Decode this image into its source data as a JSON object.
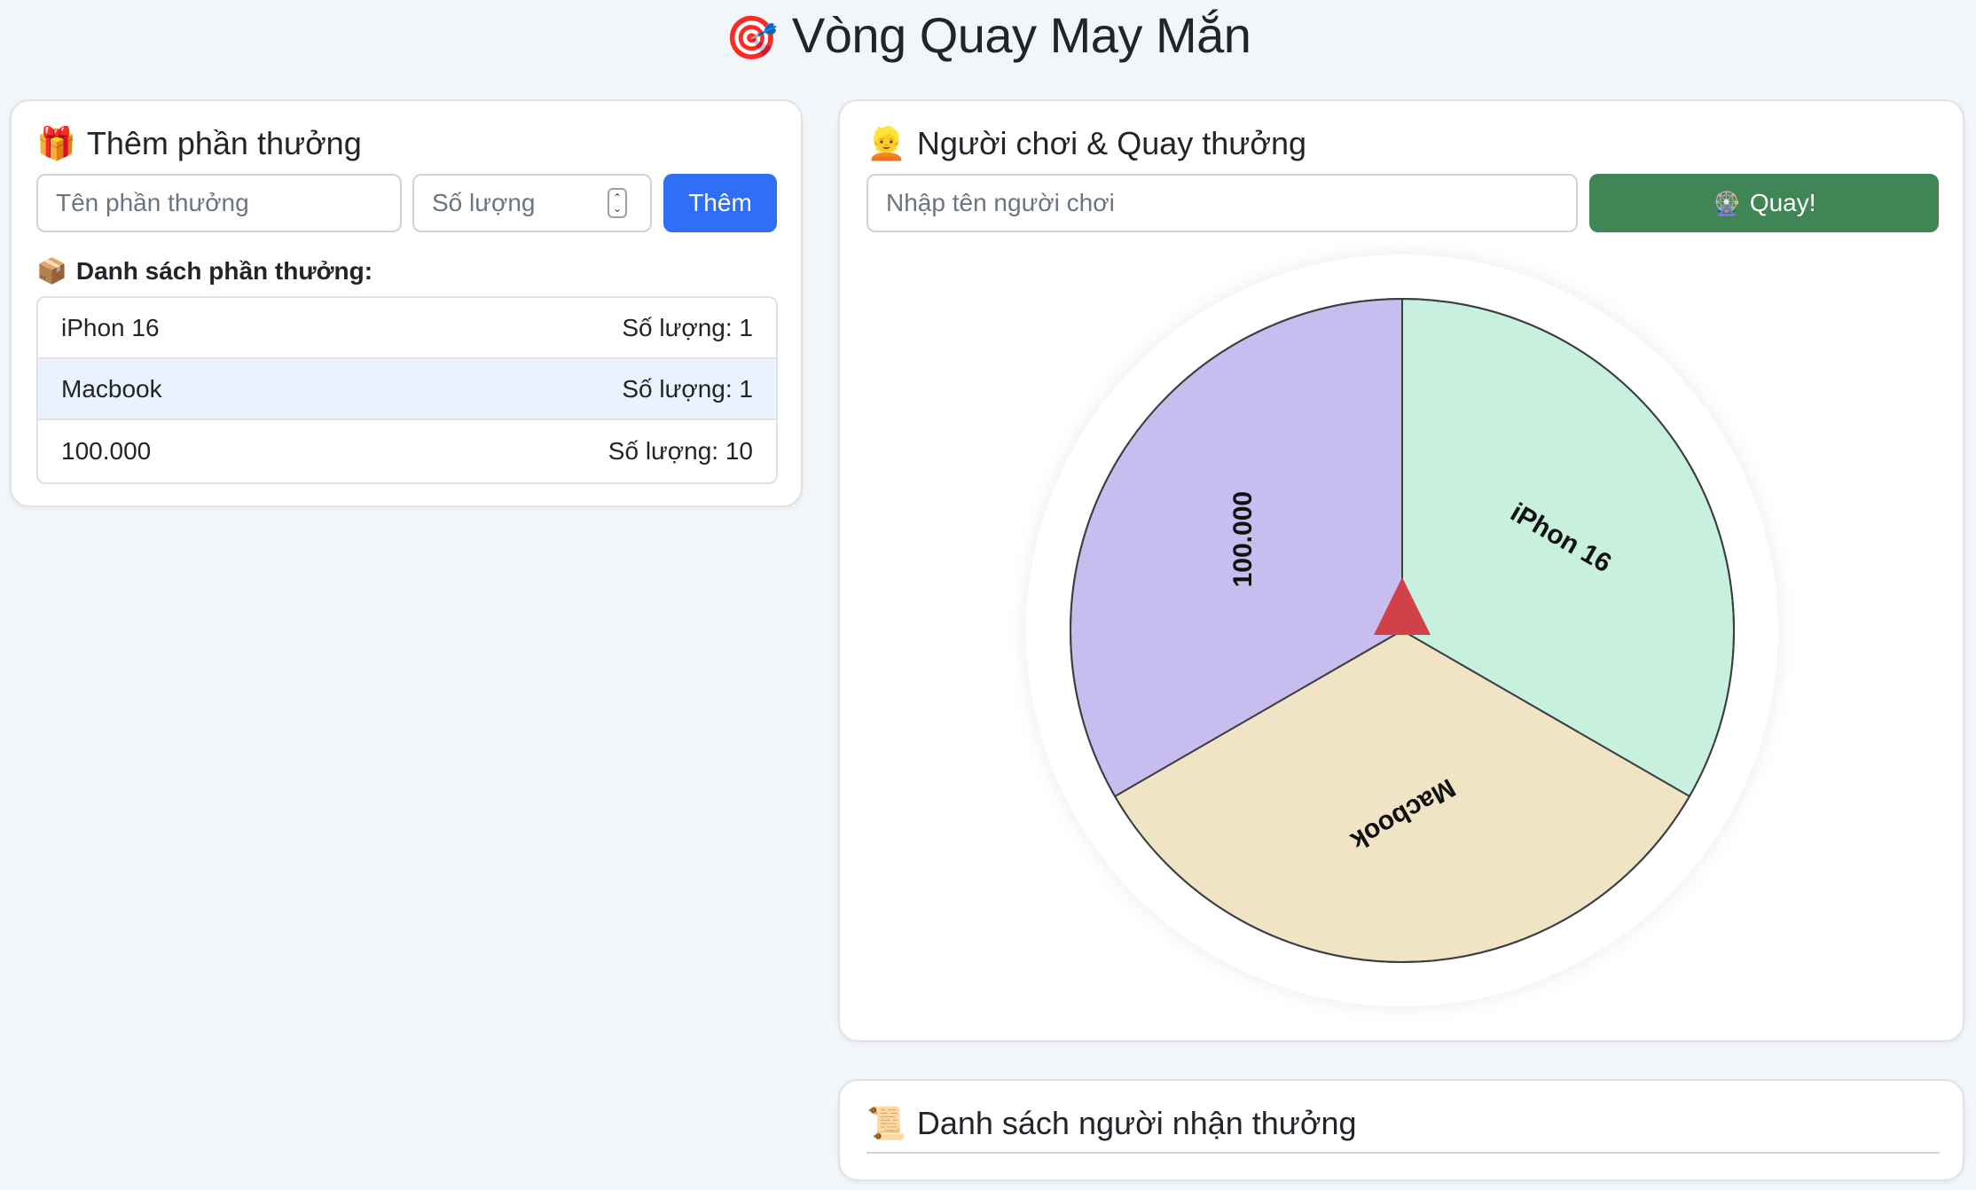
{
  "header": {
    "title_emoji": "🎯",
    "title": "Vòng Quay May Mắn"
  },
  "add_prize": {
    "title_emoji": "🎁",
    "title": "Thêm phần thưởng",
    "name_placeholder": "Tên phần thưởng",
    "quantity_placeholder": "Số lượng",
    "add_label": "Thêm",
    "list_emoji": "📦",
    "list_title": "Danh sách phần thưởng:",
    "prizes": [
      {
        "name": "iPhon 16",
        "quantity": "Số lượng: 1"
      },
      {
        "name": "Macbook",
        "quantity": "Số lượng: 1"
      },
      {
        "name": "100.000",
        "quantity": "Số lượng: 10"
      }
    ]
  },
  "player": {
    "title_emoji": "👱",
    "title": "Người chơi & Quay thưởng",
    "name_placeholder": "Nhập tên người chơi",
    "spin_emoji": "🎡",
    "spin_label": "Quay!"
  },
  "wheel": {
    "segments": [
      {
        "label": "iPhon 16",
        "color": "#c8f0de"
      },
      {
        "label": "Macbook",
        "color": "#f1e4c4"
      },
      {
        "label": "100.000",
        "color": "#c8bdef"
      }
    ],
    "pointer_color": "#d2404a",
    "border_color": "#3b3f44"
  },
  "winners": {
    "title_emoji": "📜",
    "title": "Danh sách người nhận thưởng"
  },
  "colors": {
    "primary": "#2f6ef5",
    "success": "#3f8555",
    "background": "#f3f6f9"
  }
}
